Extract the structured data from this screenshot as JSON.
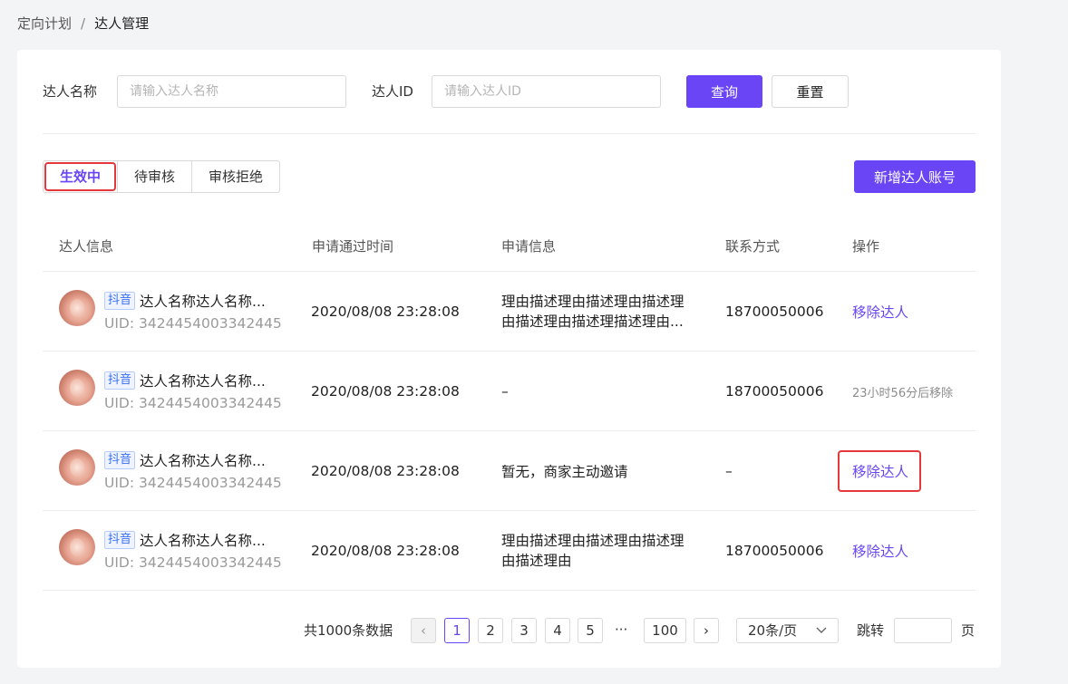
{
  "breadcrumb": {
    "parent": "定向计划",
    "separator": "/",
    "current": "达人管理"
  },
  "filter": {
    "name_label": "达人名称",
    "name_placeholder": "请输入达人名称",
    "id_label": "达人ID",
    "id_placeholder": "请输入达人ID",
    "search_label": "查询",
    "reset_label": "重置"
  },
  "tabs": [
    {
      "label": "生效中",
      "active": true
    },
    {
      "label": "待审核",
      "active": false
    },
    {
      "label": "审核拒绝",
      "active": false
    }
  ],
  "add_button_label": "新增达人账号",
  "table": {
    "headers": [
      "达人信息",
      "申请通过时间",
      "申请信息",
      "联系方式",
      "操作"
    ],
    "rows": [
      {
        "platform": "抖音",
        "name": "达人名称达人名称...",
        "uid": "UID: 3424454003342445",
        "time": "2020/08/08  23:28:08",
        "info_line1": "理由描述理由描述理由描述理",
        "info_line2": "由描述理由描述理描述理由...",
        "contact": "18700050006",
        "action": "移除达人"
      },
      {
        "platform": "抖音",
        "name": "达人名称达人名称...",
        "uid": "UID: 3424454003342445",
        "time": "2020/08/08  23:28:08",
        "info": "–",
        "contact": "18700050006",
        "action_note": "23小时56分后移除"
      },
      {
        "platform": "抖音",
        "name": "达人名称达人名称...",
        "uid": "UID: 3424454003342445",
        "time": "2020/08/08  23:28:08",
        "info": "暂无，商家主动邀请",
        "contact": "–",
        "action": "移除达人"
      },
      {
        "platform": "抖音",
        "name": "达人名称达人名称...",
        "uid": "UID: 3424454003342445",
        "time": "2020/08/08  23:28:08",
        "info_line1": "理由描述理由描述理由描述理",
        "info_line2": "由描述理由",
        "contact": "18700050006",
        "action": "移除达人"
      }
    ]
  },
  "pagination": {
    "total": "共1000条数据",
    "prev": "‹",
    "next": "›",
    "pages": [
      "1",
      "2",
      "3",
      "4",
      "5"
    ],
    "ellipsis": "···",
    "last": "100",
    "current": "1",
    "page_size": "20条/页",
    "jump_label": "跳转",
    "page_suffix": "页"
  },
  "colors": {
    "primary": "#6a45f6",
    "highlight": "#e5383b",
    "tag_blue": "#3a6ff2"
  }
}
